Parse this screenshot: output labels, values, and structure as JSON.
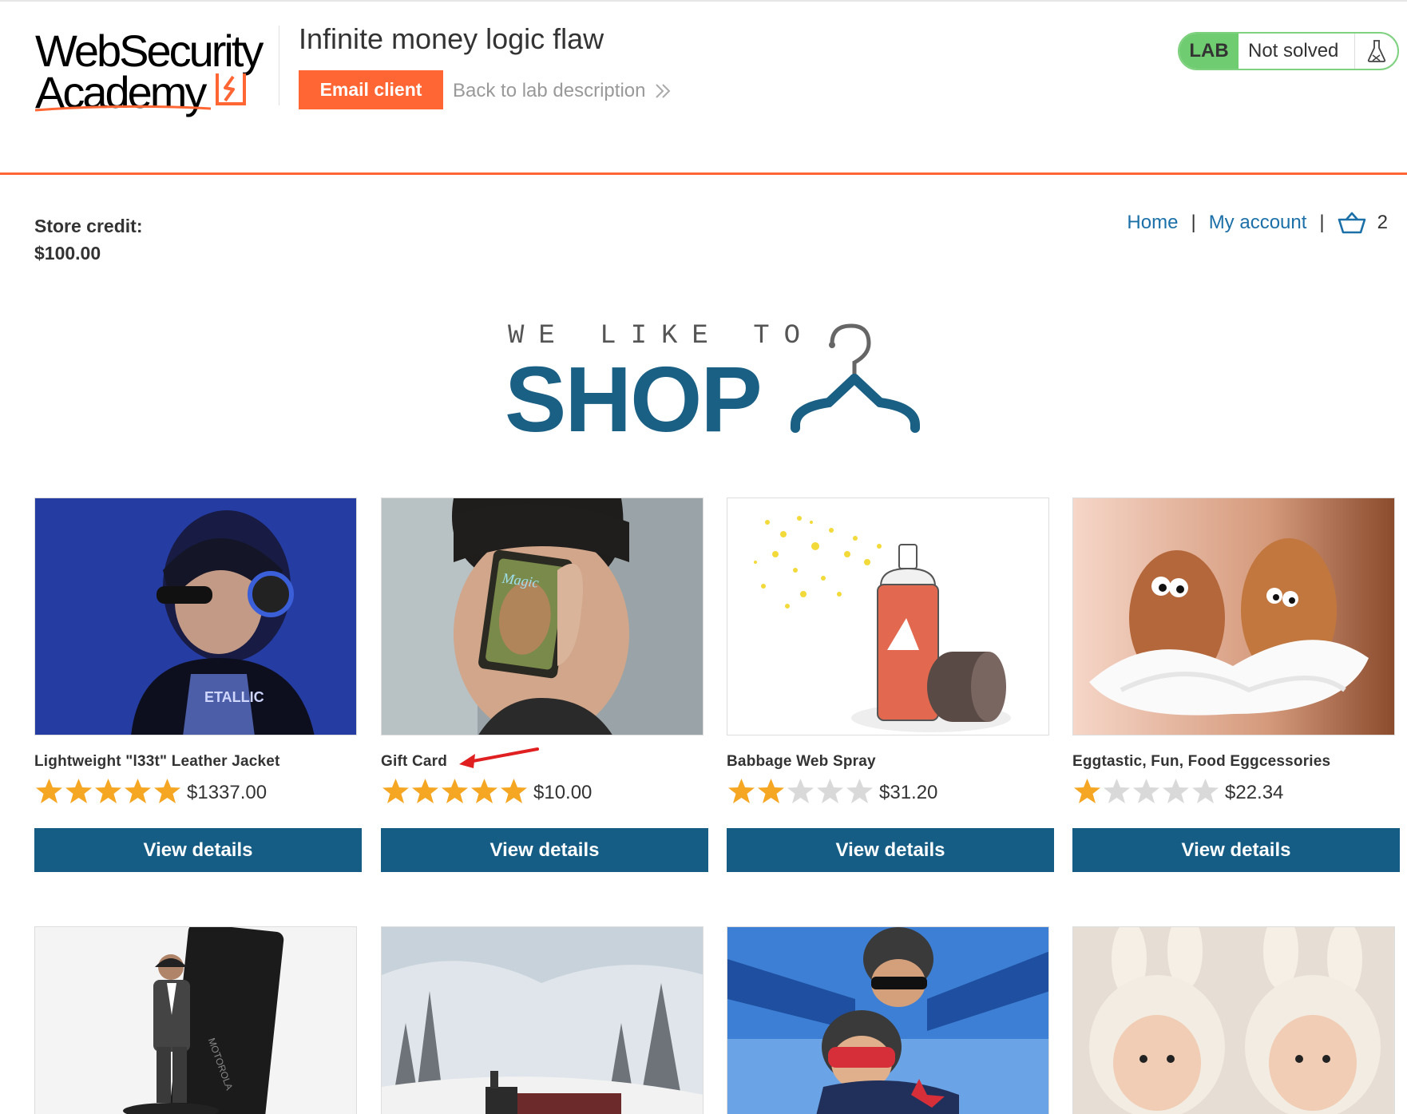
{
  "header": {
    "logo_line1": "WebSecurity",
    "logo_line2": "Academy",
    "lab_title": "Infinite money logic flaw",
    "email_button": "Email client",
    "back_link": "Back to lab description",
    "lab_badge": "LAB",
    "lab_status": "Not solved",
    "accent_color": "#ff6633",
    "lab_color": "#70cc70"
  },
  "account": {
    "credit_label": "Store credit:",
    "credit_value": "$100.00"
  },
  "nav": {
    "home": "Home",
    "my_account": "My account",
    "separator": "|",
    "cart_count": "2",
    "cart_icon": "basket-icon"
  },
  "banner": {
    "small": "WE LIKE TO",
    "big": "SHOP",
    "icon": "hanger-icon"
  },
  "products": [
    {
      "name": "Lightweight \"l33t\" Leather Jacket",
      "price": "$1337.00",
      "rating": 5,
      "button": "View details"
    },
    {
      "name": "Gift Card",
      "price": "$10.00",
      "rating": 5,
      "button": "View details"
    },
    {
      "name": "Babbage Web Spray",
      "price": "$31.20",
      "rating": 2,
      "button": "View details"
    },
    {
      "name": "Eggtastic, Fun, Food Eggcessories",
      "price": "$22.34",
      "rating": 1,
      "button": "View details"
    }
  ],
  "theme": {
    "primary_button": "#155d85",
    "link": "#1c70a8",
    "star_on": "#f5a623",
    "star_off": "#d9d9d9"
  }
}
